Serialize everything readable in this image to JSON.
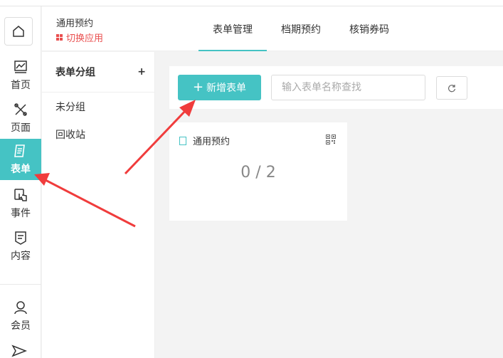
{
  "app": {
    "title": "通用预约",
    "switch_label": "切换应用"
  },
  "tabs": [
    {
      "label": "表单管理",
      "active": true
    },
    {
      "label": "档期预约",
      "active": false
    },
    {
      "label": "核销券码",
      "active": false
    }
  ],
  "rail": {
    "items": [
      {
        "label": "首页",
        "icon": "chart-icon"
      },
      {
        "label": "页面",
        "icon": "tools-icon"
      },
      {
        "label": "表单",
        "icon": "form-icon",
        "active": true
      },
      {
        "label": "事件",
        "icon": "touch-icon"
      },
      {
        "label": "内容",
        "icon": "content-icon"
      },
      {
        "label": "会员",
        "icon": "user-icon"
      }
    ]
  },
  "groups": {
    "title": "表单分组",
    "items": [
      "未分组",
      "回收站"
    ]
  },
  "toolbar": {
    "new_label": "新增表单",
    "search_placeholder": "输入表单名称查找"
  },
  "card": {
    "title": "通用预约",
    "count": "0 / 2"
  },
  "colors": {
    "accent": "#45c3c4",
    "danger": "#e94e4e",
    "arrow": "#f03c3c"
  }
}
